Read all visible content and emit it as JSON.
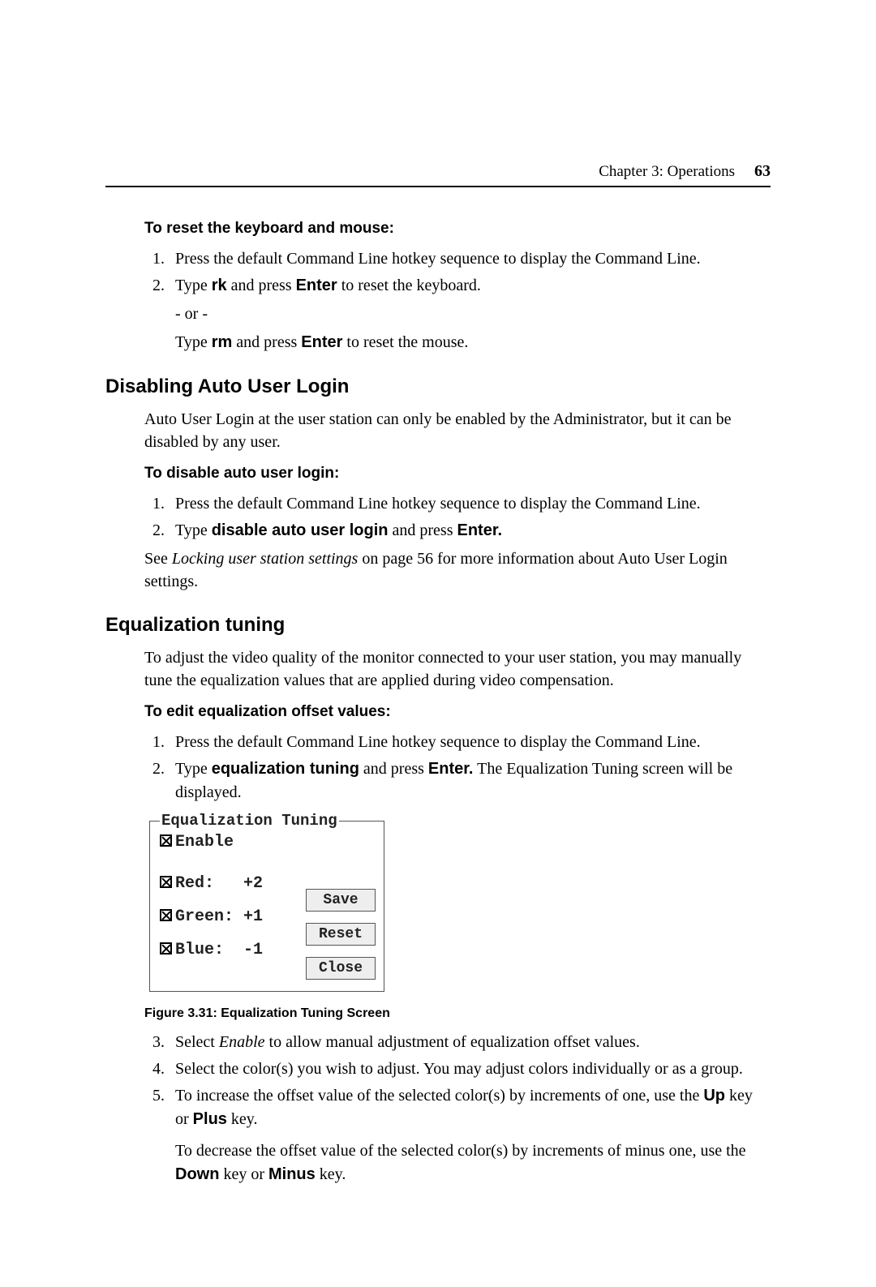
{
  "header": {
    "chapter": "Chapter 3: Operations",
    "page": "63"
  },
  "s1": {
    "title": "To reset the keyboard and mouse:",
    "step1": "Press the default Command Line hotkey sequence to display the Command Line.",
    "step2_pre": "Type ",
    "step2_b1": "rk",
    "step2_mid": " and press ",
    "step2_b2": "Enter",
    "step2_post": " to reset the keyboard.",
    "or": "- or -",
    "step2b_pre": "Type ",
    "step2b_b1": "rm",
    "step2b_mid": " and press ",
    "step2b_b2": "Enter",
    "step2b_post": " to reset the mouse."
  },
  "s2": {
    "heading": "Disabling Auto User Login",
    "intro": "Auto User Login at the user station can only be enabled by the Administrator, but it can be disabled by any user.",
    "subtitle": "To disable auto user login:",
    "step1": "Press the default Command Line hotkey sequence to display the Command Line.",
    "step2_pre": "Type ",
    "step2_b1": "disable auto user login",
    "step2_mid": " and press ",
    "step2_b2": "Enter.",
    "note_pre": " See ",
    "note_i": "Locking user station settings",
    "note_post": " on page 56 for more information about Auto User Login settings."
  },
  "s3": {
    "heading": "Equalization tuning",
    "intro": "To adjust the video quality of the monitor connected to your user station, you may manually tune the equalization values that are applied during video compensation.",
    "subtitle": "To edit equalization offset values:",
    "step1": "Press the default Command Line hotkey sequence to display the Command Line.",
    "step2_pre": "Type ",
    "step2_b1": "equalization tuning",
    "step2_mid": " and press ",
    "step2_b2": "Enter.",
    "step2_post": " The Equalization Tuning screen will be displayed.",
    "fig": {
      "title": "Equalization Tuning",
      "enable": "Enable",
      "red": "Red:   +2",
      "green": "Green: +1",
      "blue": "Blue:  -1",
      "save": "Save",
      "reset": "Reset",
      "close": "Close",
      "caption": "Figure 3.31: Equalization Tuning Screen"
    },
    "step3_pre": "Select ",
    "step3_i": "Enable",
    "step3_post": " to allow manual adjustment of equalization offset values.",
    "step4": "Select the color(s) you wish to adjust. You may adjust colors individually or as a group.",
    "step5_pre": "To increase the offset value of the selected color(s) by increments of one, use the ",
    "step5_b1": "Up",
    "step5_mid": " key or ",
    "step5_b2": "Plus",
    "step5_post": " key.",
    "step5b_pre": "To decrease the offset value of the selected color(s) by increments of minus one, use the ",
    "step5b_b1": "Down",
    "step5b_mid": " key or ",
    "step5b_b2": "Minus",
    "step5b_post": " key."
  }
}
